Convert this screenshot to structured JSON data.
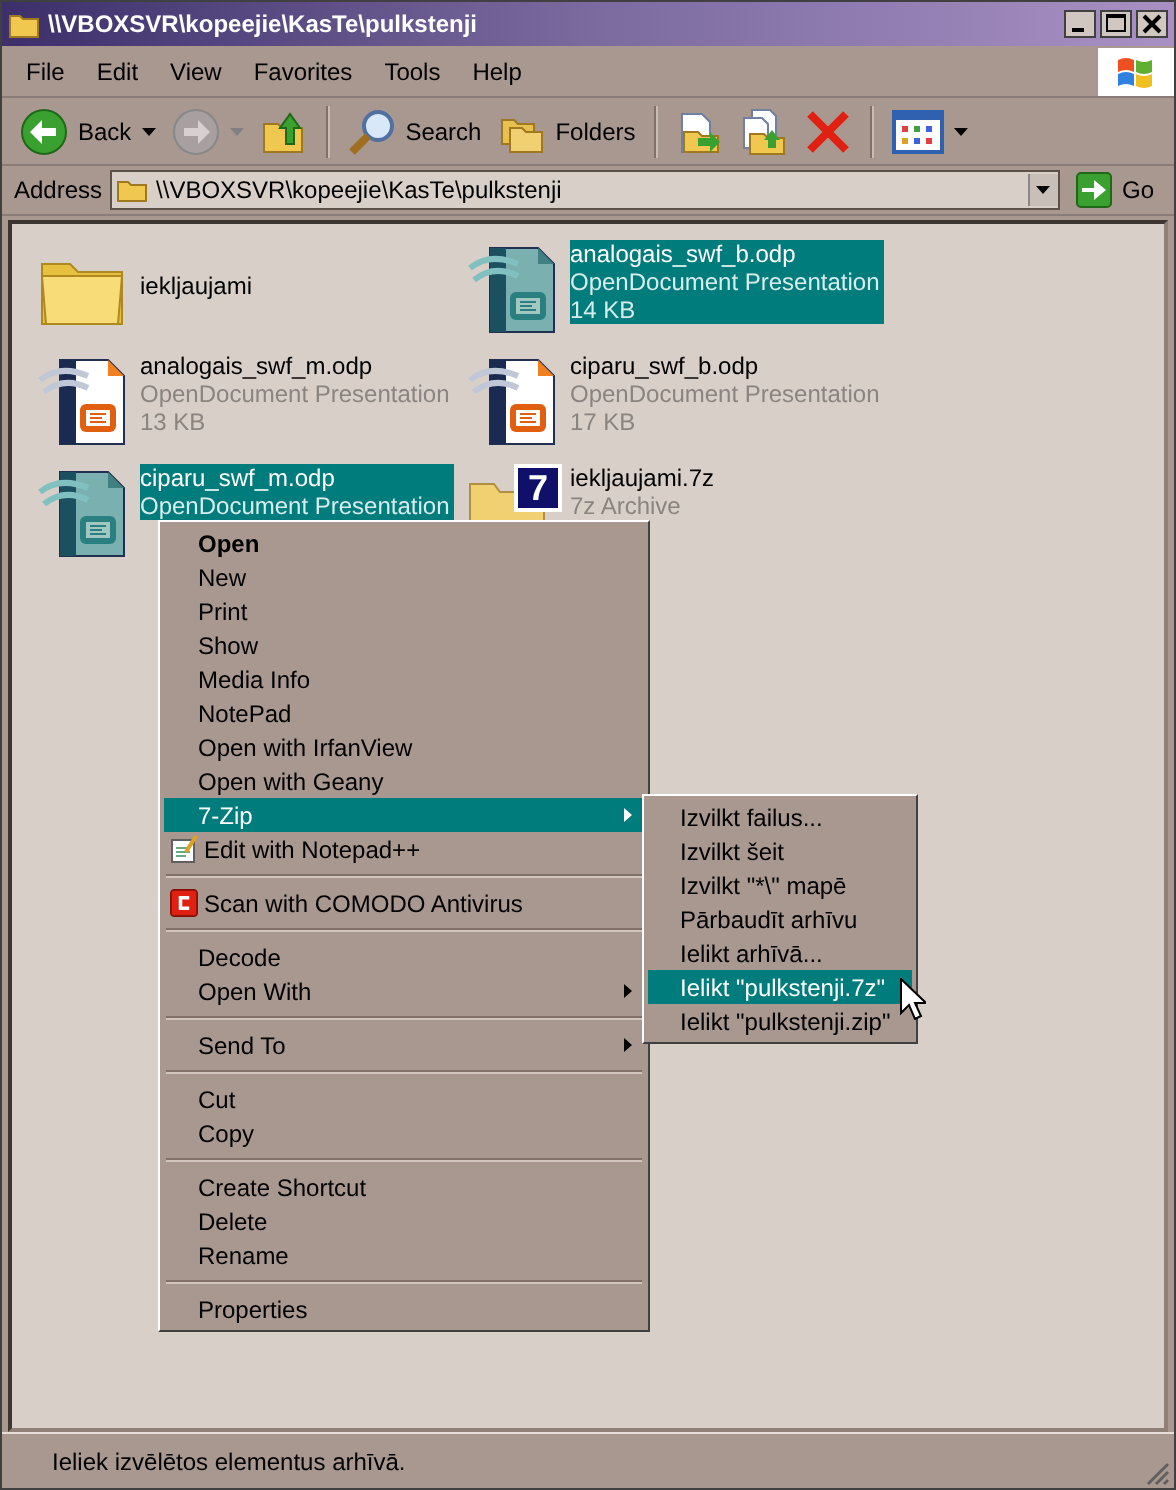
{
  "window": {
    "title": "\\\\VBOXSVR\\kopeejie\\KasTe\\pulkstenji"
  },
  "menu_bar": [
    "File",
    "Edit",
    "View",
    "Favorites",
    "Tools",
    "Help"
  ],
  "toolbar": [
    {
      "kind": "back",
      "label": "Back",
      "disabled": false
    },
    {
      "kind": "forward",
      "disabled": true
    },
    {
      "kind": "up"
    },
    {
      "kind": "separator"
    },
    {
      "kind": "search",
      "label": "Search"
    },
    {
      "kind": "folders",
      "label": "Folders"
    },
    {
      "kind": "separator"
    },
    {
      "kind": "move"
    },
    {
      "kind": "copy"
    },
    {
      "kind": "delete"
    },
    {
      "kind": "separator"
    },
    {
      "kind": "views"
    }
  ],
  "address": {
    "label": "Address",
    "value": "\\\\VBOXSVR\\kopeejie\\KasTe\\pulkstenji",
    "go": "Go"
  },
  "files": [
    {
      "kind": "folder",
      "name": "iekljaujami",
      "selected": false
    },
    {
      "kind": "odp",
      "name": "analogais_swf_b.odp",
      "type": "OpenDocument Presentation",
      "size": "14 KB",
      "selected": true
    },
    {
      "kind": "odp",
      "name": "analogais_swf_m.odp",
      "type": "OpenDocument Presentation",
      "size": "13 KB",
      "selected": false
    },
    {
      "kind": "odp",
      "name": "ciparu_swf_b.odp",
      "type": "OpenDocument Presentation",
      "size": "17 KB",
      "selected": false
    },
    {
      "kind": "odp",
      "name": "ciparu_swf_m.odp",
      "type": "OpenDocument Presentation",
      "selected": true
    },
    {
      "kind": "archive",
      "name": "iekljaujami.7z",
      "type": "7z Archive",
      "badge": "7",
      "selected": false
    }
  ],
  "context_menu": [
    {
      "kind": "plain",
      "label": "Open",
      "default": true,
      "submenu": false,
      "selected": false
    },
    {
      "kind": "plain",
      "label": "New",
      "default": false,
      "submenu": false,
      "selected": false
    },
    {
      "kind": "plain",
      "label": "Print",
      "default": false,
      "submenu": false,
      "selected": false
    },
    {
      "kind": "plain",
      "label": "Show",
      "default": false,
      "submenu": false,
      "selected": false
    },
    {
      "kind": "plain",
      "label": "Media Info",
      "default": false,
      "submenu": false,
      "selected": false
    },
    {
      "kind": "plain",
      "label": "NotePad",
      "default": false,
      "submenu": false,
      "selected": false
    },
    {
      "kind": "plain",
      "label": "Open with IrfanView",
      "default": false,
      "submenu": false,
      "selected": false
    },
    {
      "kind": "plain",
      "label": "Open with Geany",
      "default": false,
      "submenu": false,
      "selected": false
    },
    {
      "kind": "plain",
      "label": "7-Zip",
      "default": false,
      "submenu": true,
      "selected": true
    },
    {
      "kind": "notepad",
      "label": "Edit with Notepad++",
      "default": false,
      "submenu": false,
      "selected": false
    },
    {
      "kind": "separator"
    },
    {
      "kind": "antivirus",
      "label": "Scan with COMODO Antivirus",
      "default": false,
      "submenu": false,
      "selected": false
    },
    {
      "kind": "separator"
    },
    {
      "kind": "plain",
      "label": "Decode",
      "default": false,
      "submenu": false,
      "selected": false
    },
    {
      "kind": "plain",
      "label": "Open With",
      "default": false,
      "submenu": true,
      "selected": false
    },
    {
      "kind": "separator"
    },
    {
      "kind": "plain",
      "label": "Send To",
      "default": false,
      "submenu": true,
      "selected": false
    },
    {
      "kind": "separator"
    },
    {
      "kind": "plain",
      "label": "Cut",
      "default": false,
      "submenu": false,
      "selected": false
    },
    {
      "kind": "plain",
      "label": "Copy",
      "default": false,
      "submenu": false,
      "selected": false
    },
    {
      "kind": "separator"
    },
    {
      "kind": "plain",
      "label": "Create Shortcut",
      "default": false,
      "submenu": false,
      "selected": false
    },
    {
      "kind": "plain",
      "label": "Delete",
      "default": false,
      "submenu": false,
      "selected": false
    },
    {
      "kind": "plain",
      "label": "Rename",
      "default": false,
      "submenu": false,
      "selected": false
    },
    {
      "kind": "separator"
    },
    {
      "kind": "plain",
      "label": "Properties",
      "default": false,
      "submenu": false,
      "selected": false
    }
  ],
  "submenu": [
    {
      "label": "Izvilkt failus...",
      "selected": false
    },
    {
      "label": "Izvilkt šeit",
      "selected": false
    },
    {
      "label": "Izvilkt \"*\\\" mapē",
      "selected": false
    },
    {
      "label": "Pārbaudīt arhīvu",
      "selected": false
    },
    {
      "label": "Ielikt arhīvā...",
      "selected": false
    },
    {
      "label": "Ielikt \"pulkstenji.7z\"",
      "selected": true
    },
    {
      "label": "Ielikt \"pulkstenji.zip\"",
      "selected": false
    }
  ],
  "status_bar": {
    "text": "Ieliek izvēlētos elementus arhīvā."
  }
}
